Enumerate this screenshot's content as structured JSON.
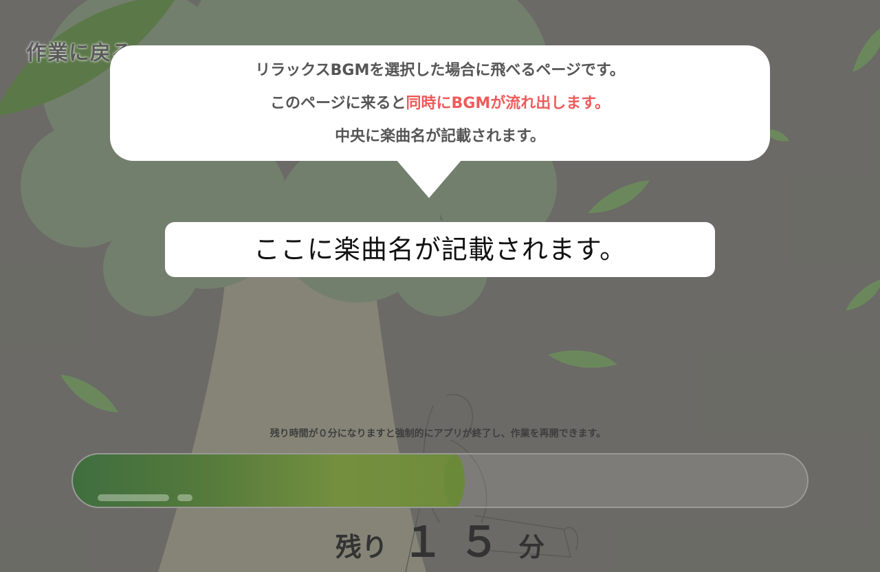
{
  "nav": {
    "back_label": "作業に戻る"
  },
  "tooltip": {
    "line1": "リラックスBGMを選択した場合に飛べるページです。",
    "line2_prefix": "このページに来ると",
    "line2_highlight": "同時にBGMが流れ出します。",
    "line3": "中央に楽曲名が記載されます。",
    "highlight_color": "#ef5a5a"
  },
  "song": {
    "title": "ここに楽曲名が記載されます。"
  },
  "timer": {
    "notice": "残り時間が０分になりますと強制的にアプリが終了し、作業を再開できます。",
    "remaining_label": "残り",
    "remaining_value": "１５",
    "remaining_unit": "分",
    "progress_fraction": 0.52
  },
  "colors": {
    "progress_fill_start": "#3f6e3e",
    "progress_fill_end": "#74903f",
    "accent_red": "#ef5a5a"
  }
}
